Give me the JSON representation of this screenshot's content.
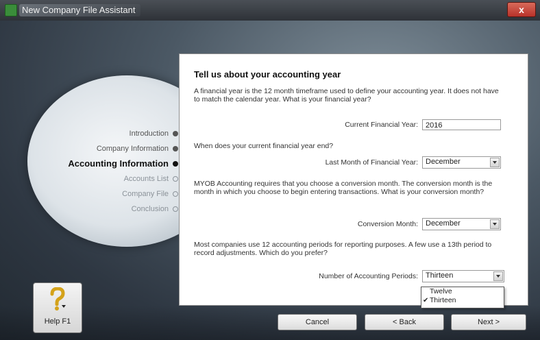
{
  "window": {
    "title": "New Company File Assistant",
    "close_label": "x"
  },
  "nav": {
    "items": [
      {
        "label": "Introduction",
        "state": "done"
      },
      {
        "label": "Company Information",
        "state": "done"
      },
      {
        "label": "Accounting Information",
        "state": "current"
      },
      {
        "label": "Accounts List",
        "state": "todo"
      },
      {
        "label": "Company File",
        "state": "todo"
      },
      {
        "label": "Conclusion",
        "state": "todo"
      }
    ]
  },
  "content": {
    "heading": "Tell us about your accounting year",
    "intro": "A financial year is the 12 month timeframe used to define your accounting year.  It does not have to match the calendar year.  What is your financial year?",
    "current_year_label": "Current Financial Year:",
    "current_year_value": "2016",
    "end_question": "When does your current financial year end?",
    "last_month_label": "Last Month of Financial Year:",
    "last_month_value": "December",
    "conversion_text": "MYOB Accounting requires that you choose a conversion month.  The conversion month is the month in which you choose to begin entering transactions.  What is your conversion month?",
    "conversion_label": "Conversion Month:",
    "conversion_value": "December",
    "periods_text": "Most companies use 12 accounting periods for reporting purposes.  A few use a 13th period to record adjustments.  Which do you prefer?",
    "periods_label": "Number of Accounting Periods:",
    "periods_value": "Thirteen",
    "periods_options": [
      "Twelve",
      "Thirteen"
    ],
    "checkmark": "✔"
  },
  "buttons": {
    "help": "Help F1",
    "cancel": "Cancel",
    "back": "< Back",
    "next": "Next >"
  },
  "colors": {
    "accent_green": "#3a8d3a",
    "close_red": "#b8322a"
  }
}
